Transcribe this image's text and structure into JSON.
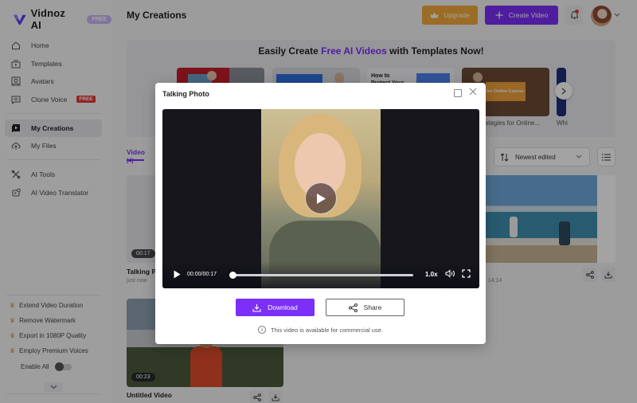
{
  "app": {
    "name": "Vidnoz AI",
    "plan_badge": "FREE"
  },
  "header": {
    "title": "My Creations",
    "upgrade_label": "Upgrade",
    "create_video_label": "Create Video",
    "caret": "⌄"
  },
  "sidebar": {
    "items": [
      {
        "label": "Home",
        "icon": "home-icon"
      },
      {
        "label": "Templates",
        "icon": "templates-icon"
      },
      {
        "label": "Avatars",
        "icon": "avatar-icon"
      },
      {
        "label": "Clone Voice",
        "icon": "voice-icon",
        "badge": "FREE"
      },
      {
        "label": "My Creations",
        "icon": "creations-icon",
        "active": true
      },
      {
        "label": "My Files",
        "icon": "cloud-upload-icon"
      },
      {
        "label": "AI Tools",
        "icon": "tools-icon"
      },
      {
        "label": "AI Video Translator",
        "icon": "translator-icon"
      }
    ],
    "perks": [
      "Extend Video Duration",
      "Remove Watermark",
      "Export in 1080P Quality",
      "Employ Premium Voices"
    ],
    "enable_all_label": "Enable All",
    "enable_all_on": false,
    "crown": "♛",
    "collapse_glyph": "⌄"
  },
  "banner": {
    "title_pre": "Easily Create ",
    "title_highlight": "Free AI Videos",
    "title_post": " with Templates Now!",
    "templates": [
      {
        "caption": ""
      },
      {
        "caption": ""
      },
      {
        "caption": "",
        "thumb_text": "How to Protect Your"
      },
      {
        "caption": "rategies for Online...",
        "thumb_text": "for Online Course."
      },
      {
        "caption": "Whi"
      }
    ],
    "next_glyph": "›"
  },
  "creations": {
    "tab_label": "Video",
    "tab_count": "(4)",
    "sort_selected": "Newest edited",
    "sort_caret": "⌄",
    "cards": [
      {
        "title": "Talking Ph",
        "subtitle": "just now",
        "duration": "00:17"
      },
      {
        "title": "",
        "subtitle": "34 14:14",
        "duration": ""
      },
      {
        "title": "Untitled Video",
        "subtitle": "",
        "duration": "00:23"
      }
    ]
  },
  "modal": {
    "title": "Talking Photo",
    "close_glyph": "✕",
    "player": {
      "time": "00:00/00:17",
      "progress_fraction": 0.0,
      "speed": "1.0x"
    },
    "download_label": "Download",
    "share_label": "Share",
    "note": "This video is available for commercial use.",
    "info_glyph": "i"
  },
  "colors": {
    "accent": "#7b2ff7",
    "upgrade": "#f3a93b",
    "free_badge": "#e53935"
  }
}
